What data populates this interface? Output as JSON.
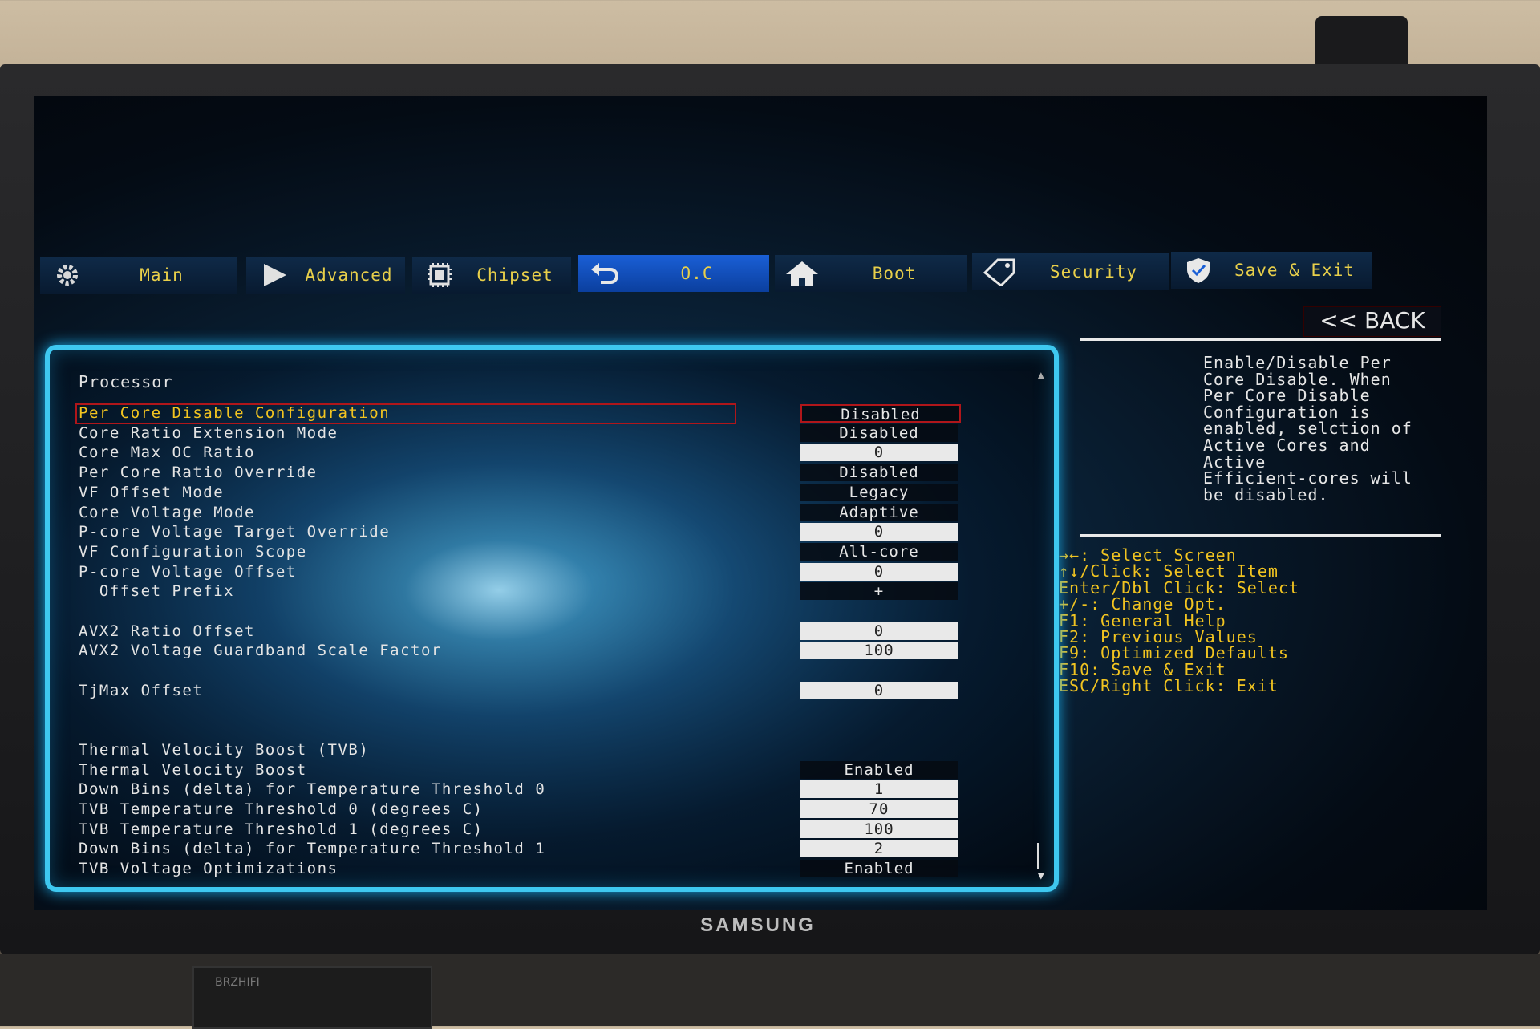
{
  "tabs": [
    {
      "label": "Main",
      "icon": "gear-icon",
      "active": false
    },
    {
      "label": "Advanced",
      "icon": "play-icon",
      "active": false
    },
    {
      "label": "Chipset",
      "icon": "chip-icon",
      "active": false
    },
    {
      "label": "O.C",
      "icon": "undo-arrow-icon",
      "active": true
    },
    {
      "label": "Boot",
      "icon": "home-icon",
      "active": false
    },
    {
      "label": "Security",
      "icon": "tag-icon",
      "active": false
    },
    {
      "label": "Save & Exit",
      "icon": "shield-icon",
      "active": false
    }
  ],
  "back_label": "<< BACK",
  "panel": {
    "title": "Processor",
    "rows": [
      {
        "label": "Per Core Disable Configuration",
        "value": "Disabled",
        "kind": "text",
        "selected": true
      },
      {
        "label": "Core Ratio Extension Mode",
        "value": "Disabled",
        "kind": "text"
      },
      {
        "label": "Core Max OC Ratio",
        "value": "0",
        "kind": "box"
      },
      {
        "label": "Per Core Ratio Override",
        "value": "Disabled",
        "kind": "text"
      },
      {
        "label": "VF Offset Mode",
        "value": "Legacy",
        "kind": "text"
      },
      {
        "label": "Core Voltage Mode",
        "value": "Adaptive",
        "kind": "text"
      },
      {
        "label": "P-core Voltage Target Override",
        "value": "0",
        "kind": "box"
      },
      {
        "label": "VF Configuration Scope",
        "value": "All-core",
        "kind": "text"
      },
      {
        "label": "P-core Voltage Offset",
        "value": "0",
        "kind": "box"
      },
      {
        "label": "  Offset Prefix",
        "value": "+",
        "kind": "text"
      },
      {
        "label": "",
        "value": "",
        "kind": "none"
      },
      {
        "label": "AVX2 Ratio Offset",
        "value": "0",
        "kind": "box"
      },
      {
        "label": "AVX2 Voltage Guardband Scale Factor",
        "value": "100",
        "kind": "box"
      },
      {
        "label": "",
        "value": "",
        "kind": "none"
      },
      {
        "label": "TjMax Offset",
        "value": "0",
        "kind": "box"
      },
      {
        "label": "",
        "value": "",
        "kind": "none"
      },
      {
        "label": "",
        "value": "",
        "kind": "none"
      },
      {
        "label": "Thermal Velocity Boost (TVB)",
        "value": "",
        "kind": "none"
      },
      {
        "label": "Thermal Velocity Boost",
        "value": "Enabled",
        "kind": "text"
      },
      {
        "label": "Down Bins (delta) for Temperature Threshold 0",
        "value": "1",
        "kind": "box"
      },
      {
        "label": "TVB Temperature Threshold 0 (degrees C)",
        "value": "70",
        "kind": "box"
      },
      {
        "label": "TVB Temperature Threshold 1 (degrees C)",
        "value": "100",
        "kind": "box"
      },
      {
        "label": "Down Bins (delta) for Temperature Threshold 1",
        "value": "2",
        "kind": "box"
      },
      {
        "label": "TVB Voltage Optimizations",
        "value": "Enabled",
        "kind": "text"
      }
    ]
  },
  "help_text": [
    "Enable/Disable Per",
    "Core Disable. When",
    "Per Core Disable",
    "Configuration is",
    "enabled, selction of",
    "Active Cores and",
    "Active",
    "Efficient-cores will",
    "be disabled."
  ],
  "key_hints": [
    "→←: Select Screen",
    "↑↓/Click: Select Item",
    "Enter/Dbl Click: Select",
    "+/-: Change Opt.",
    "F1: General Help",
    "F2: Previous Values",
    "F9: Optimized Defaults",
    "F10: Save & Exit",
    "ESC/Right Click: Exit"
  ],
  "monitor_brand": "SAMSUNG",
  "amp_brand": "BRZHIFI",
  "colors": {
    "accent_yellow": "#f2c420",
    "active_tab": "#1a5fd6",
    "frame_cyan": "#3ec8f0",
    "select_red": "#b0161a"
  }
}
